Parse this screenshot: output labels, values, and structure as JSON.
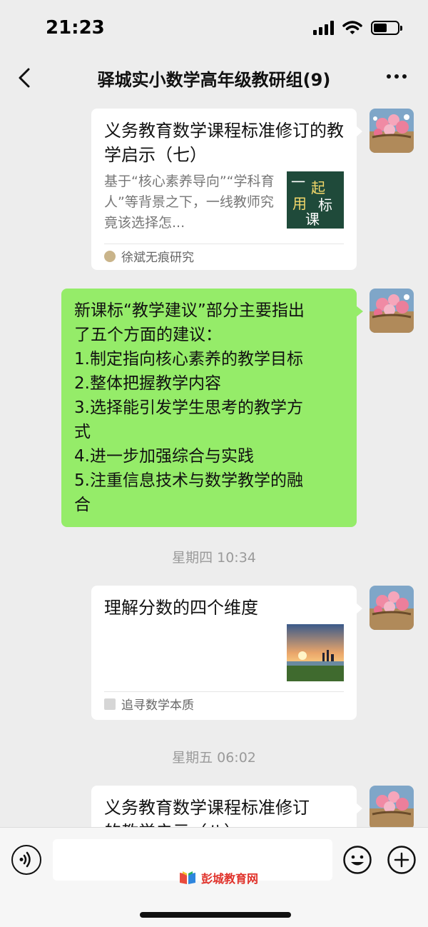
{
  "status_bar": {
    "time": "21:23",
    "battery_level": 0.55
  },
  "header": {
    "title": "驿城实小数学高年级教研组(9)"
  },
  "messages": [
    {
      "type": "link_card",
      "title": "义务教育数学课程标准修订的教学启示（七）",
      "description": "基于“核心素养导向”“学科育人”等背景之下，一线教师究竟该选择怎...",
      "thumbnail_text": [
        "一",
        "起",
        "用",
        "标",
        "课"
      ],
      "source": "徐斌无痕研究"
    },
    {
      "type": "text",
      "lines": [
        "新课标“教学建议”部分主要指出",
        "了五个方面的建议：",
        "1.制定指向核心素养的教学目标",
        "2.整体把握教学内容",
        "3.选择能引发学生思考的教学方",
        "式",
        "4.进一步加强综合与实践",
        "5.注重信息技术与数学教学的融",
        "合"
      ]
    },
    {
      "type": "time",
      "text": "星期四 10:34"
    },
    {
      "type": "link_card",
      "title": "理解分数的四个维度",
      "source": "追寻数学本质"
    },
    {
      "type": "time",
      "text": "星期五 06:02"
    },
    {
      "type": "link_card",
      "title_partial": "义务教育数学课程标准修订",
      "title_cut": "的教学启示（八）"
    }
  ],
  "input_bar": {
    "placeholder": ""
  },
  "watermark": {
    "text": "彭城教育网"
  },
  "colors": {
    "self_bubble": "#95ec69",
    "background": "#ededed",
    "card": "#ffffff"
  },
  "icons": [
    "back-arrow-icon",
    "more-icon",
    "voice-icon",
    "emoji-icon",
    "plus-icon",
    "signal-icon",
    "wifi-icon",
    "battery-icon"
  ]
}
